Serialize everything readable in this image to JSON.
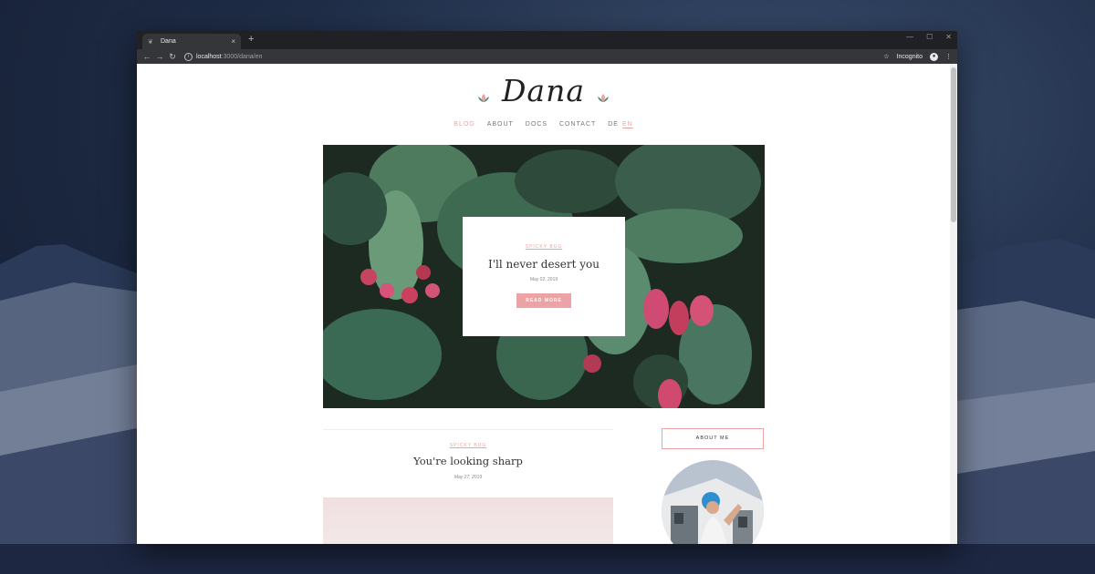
{
  "browser": {
    "tab_title": "Dana",
    "new_tab_label": "+",
    "tab_close": "×",
    "url_host": "localhost",
    "url_path": ":3000/dana/en",
    "incognito_label": "Incognito"
  },
  "site": {
    "logo": "Dana",
    "nav": [
      {
        "label": "BLOG"
      },
      {
        "label": "ABOUT"
      },
      {
        "label": "DOCS"
      },
      {
        "label": "CONTACT"
      }
    ],
    "languages": [
      "DE",
      "EN"
    ]
  },
  "featured": {
    "category": "SPICKY BUG",
    "title": "I'll never desert you",
    "date": "May 02, 2019",
    "button": "READ MORE"
  },
  "post": {
    "category": "SPICKY BUG",
    "title": "You're looking sharp",
    "date": "May 27, 2019"
  },
  "sidebar": {
    "about_title": "ABOUT ME"
  },
  "colors": {
    "accent": "#eba3a6",
    "chrome_dark": "#202124",
    "chrome_toolbar": "#35363a"
  }
}
